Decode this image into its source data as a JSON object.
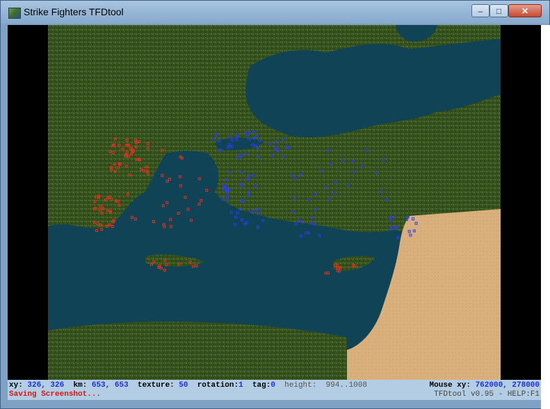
{
  "window": {
    "title": "Strike Fighters TFDtool"
  },
  "controls": {
    "minimize": "–",
    "maximize": "□",
    "close": "✕"
  },
  "colors": {
    "sea": "#0f4355",
    "land": "#34511e",
    "land_light": "#4f6e2c",
    "desert": "#d9b07c",
    "red_markers": "#e63020",
    "blue_markers": "#2b3cf0",
    "status_bg": "#b3cde4"
  },
  "status": {
    "xy_label": "xy:",
    "xy_value": "326, 326",
    "km_label": "km:",
    "km_value": "653, 653",
    "texture_label": "texture:",
    "texture_value": "50",
    "rotation_label": "rotation:",
    "rotation_value": "1",
    "tag_label": "tag:",
    "tag_value": "0",
    "height_label": "height:",
    "height_value": "994..1008",
    "mouse_label": "Mouse xy:",
    "mouse_value": "762000, 278000",
    "message": "Saving Screenshot...",
    "version": "TFDtool v0.95 - HELP:F1"
  },
  "icons": [
    "app-icon",
    "minimize-icon",
    "maximize-icon",
    "close-icon"
  ]
}
